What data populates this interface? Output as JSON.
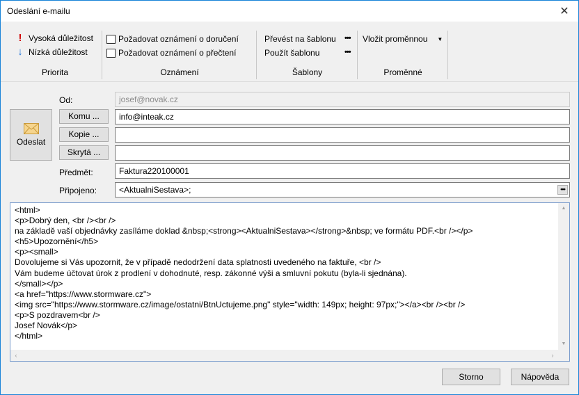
{
  "window": {
    "title": "Odeslání e-mailu",
    "close_glyph": "✕"
  },
  "ribbon": {
    "priority": {
      "title": "Priorita",
      "high": "Vysoká důležitost",
      "low": "Nízká důležitost",
      "high_icon": "!",
      "low_icon": "↓"
    },
    "notification": {
      "title": "Oznámení",
      "delivery": "Požadovat oznámení o doručení",
      "read": "Požadovat oznámení o přečtení"
    },
    "templates": {
      "title": "Šablony",
      "convert": "Převést na šablonu",
      "use": "Použít šablonu",
      "more": "•••"
    },
    "variables": {
      "title": "Proměnné",
      "insert": "Vložit proměnnou",
      "caret": "▼"
    }
  },
  "form": {
    "send_label": "Odeslat",
    "from_label": "Od:",
    "from_value": "josef@novak.cz",
    "to_button": "Komu ...",
    "to_value": "info@inteak.cz",
    "cc_button": "Kopie ...",
    "cc_value": "",
    "bcc_button": "Skrytá ...",
    "bcc_value": "",
    "subject_label": "Předmět:",
    "subject_value": "Faktura220100001",
    "attached_label": "Připojeno:",
    "attached_value": "<AktualniSestava>;",
    "ellipsis": "•••"
  },
  "body_html": "<html>\n<p>Dobrý den, <br /><br />\nna základě vaší objednávky zasíláme doklad &nbsp;<strong><AktualniSestava></strong>&nbsp; ve formátu PDF.<br /></p>\n<h5>Upozornění</h5>\n<p><small>\nDovolujeme si Vás upozornit, že v případě nedodržení data splatnosti uvedeného na faktuře, <br />\nVám budeme účtovat úrok z prodlení v dohodnuté, resp. zákonné výši a smluvní pokutu (byla-li sjednána).\n</small></p>\n<a href=\"https://www.stormware.cz\">\n<img src=\"https://www.stormware.cz/image/ostatni/BtnUctujeme.png\" style=\"width: 149px; height: 97px;\"></a><br /><br />\n<p>S pozdravem<br />\nJosef Novák</p>\n</html>",
  "buttons": {
    "cancel": "Storno",
    "help": "Nápověda"
  },
  "colors": {
    "accent": "#1783d8",
    "high_priority": "#d00000",
    "low_priority": "#1e73d8"
  }
}
